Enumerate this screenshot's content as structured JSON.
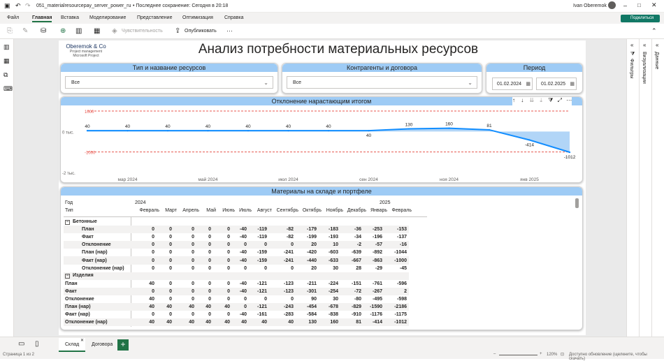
{
  "window": {
    "title": "051_materialresourcepay_server_power_ru",
    "saved": "• Последнее сохранение: Сегодня в 20:18",
    "user": "Ivan Oberemok"
  },
  "menu": [
    "Файл",
    "Главная",
    "Вставка",
    "Моделирование",
    "Представление",
    "Оптимизация",
    "Справка"
  ],
  "share": "Поделиться",
  "toolbar": {
    "sensitivity": "Чувствительность",
    "publish": "Опубликовать",
    "more": "···"
  },
  "logo": {
    "name": "Oberemok & Co",
    "line1": "Project management",
    "line2": "Microsoft Project"
  },
  "page_title": "Анализ потребности материальных ресурсов",
  "filters": {
    "res_title": "Тип и название ресурсов",
    "res_value": "Все",
    "ctr_title": "Контрагенты и договора",
    "ctr_value": "Все",
    "period_title": "Период",
    "date_from": "01.02.2024",
    "date_to": "01.02.2025"
  },
  "chart_title": "Отклонение нарастающим итогом",
  "chart_data": {
    "type": "line",
    "x": [
      "фев 2024",
      "мар 2024",
      "апр 2024",
      "май 2024",
      "июн 2024",
      "июл 2024",
      "авг 2024",
      "сен 2024",
      "окт 2024",
      "ноя 2024",
      "дек 2024",
      "янв 2025",
      "фев 2025"
    ],
    "values": [
      40,
      40,
      40,
      40,
      40,
      40,
      40,
      40,
      130,
      160,
      81,
      -414,
      -1012
    ],
    "value_labels": [
      "40",
      "40",
      "40",
      "40",
      "40",
      "40",
      "40",
      "40",
      "130",
      "160",
      "81",
      "-414",
      "-1012"
    ],
    "ref_lines": {
      "upper": 1000,
      "lower": -1000,
      "upper_label": "1000",
      "lower_label": "-1000"
    },
    "y_ticks": [
      "0 тыс.",
      "-2 тыс."
    ],
    "x_ticks": [
      "мар 2024",
      "май 2024",
      "июл 2024",
      "сен 2024",
      "ноя 2024",
      "янв 2025"
    ],
    "ylim": [
      -2000,
      1000
    ]
  },
  "matrix": {
    "title": "Материалы на складе и портфеле",
    "row_hdr1": "Год",
    "row_hdr2": "Тип",
    "year1": "2024",
    "year2": "2025",
    "months": [
      "Февраль",
      "Март",
      "Апрель",
      "Май",
      "Июнь",
      "Июль",
      "Август",
      "Сентябрь",
      "Октябрь",
      "Ноябрь",
      "Декабрь",
      "Январь",
      "Февраль"
    ],
    "rows": [
      {
        "label": "Бетонные",
        "group": true,
        "values": []
      },
      {
        "label": "План",
        "values": [
          "0",
          "0",
          "0",
          "0",
          "0",
          "-40",
          "-119",
          "-82",
          "-179",
          "-183",
          "-36",
          "-253",
          "-153"
        ]
      },
      {
        "label": "Факт",
        "values": [
          "0",
          "0",
          "0",
          "0",
          "0",
          "-40",
          "-119",
          "-82",
          "-199",
          "-193",
          "-34",
          "-196",
          "-137"
        ]
      },
      {
        "label": "Отклонение",
        "values": [
          "0",
          "0",
          "0",
          "0",
          "0",
          "0",
          "0",
          "0",
          "20",
          "10",
          "-2",
          "-57",
          "-16"
        ]
      },
      {
        "label": "План (нар)",
        "values": [
          "0",
          "0",
          "0",
          "0",
          "0",
          "-40",
          "-159",
          "-241",
          "-420",
          "-603",
          "-639",
          "-892",
          "-1044"
        ]
      },
      {
        "label": "Факт (нар)",
        "values": [
          "0",
          "0",
          "0",
          "0",
          "0",
          "-40",
          "-159",
          "-241",
          "-440",
          "-633",
          "-667",
          "-863",
          "-1000"
        ]
      },
      {
        "label": "Отклонение (нар)",
        "values": [
          "0",
          "0",
          "0",
          "0",
          "0",
          "0",
          "0",
          "0",
          "20",
          "30",
          "28",
          "-29",
          "-45"
        ]
      },
      {
        "label": "Изделия",
        "group": true,
        "values": []
      },
      {
        "label": "План",
        "total": true,
        "values": [
          "40",
          "0",
          "0",
          "0",
          "0",
          "-40",
          "-121",
          "-123",
          "-211",
          "-224",
          "-151",
          "-761",
          "-596"
        ]
      },
      {
        "label": "Факт",
        "total": true,
        "values": [
          "0",
          "0",
          "0",
          "0",
          "0",
          "-40",
          "-121",
          "-123",
          "-301",
          "-254",
          "-72",
          "-267",
          "2"
        ]
      },
      {
        "label": "Отклонение",
        "total": true,
        "values": [
          "40",
          "0",
          "0",
          "0",
          "0",
          "0",
          "0",
          "0",
          "90",
          "30",
          "-80",
          "-495",
          "-598"
        ]
      },
      {
        "label": "План (нар)",
        "total": true,
        "values": [
          "40",
          "40",
          "40",
          "40",
          "40",
          "0",
          "-121",
          "-243",
          "-454",
          "-678",
          "-829",
          "-1590",
          "-2186"
        ]
      },
      {
        "label": "Факт (нар)",
        "total": true,
        "values": [
          "0",
          "0",
          "0",
          "0",
          "0",
          "-40",
          "-161",
          "-283",
          "-584",
          "-838",
          "-910",
          "-1176",
          "-1175"
        ]
      },
      {
        "label": "Отклонение (нар)",
        "total": true,
        "values": [
          "40",
          "40",
          "40",
          "40",
          "40",
          "40",
          "40",
          "40",
          "130",
          "160",
          "81",
          "-414",
          "-1012"
        ]
      }
    ]
  },
  "tabs": [
    "Склад",
    "Договора"
  ],
  "right_panels": [
    "Фильтры",
    "Визуализации",
    "Данные"
  ],
  "status": {
    "page": "Страница 1 из 2",
    "zoom": "120%",
    "update": "Доступно обновление (щелкните, чтобы скачать)"
  }
}
